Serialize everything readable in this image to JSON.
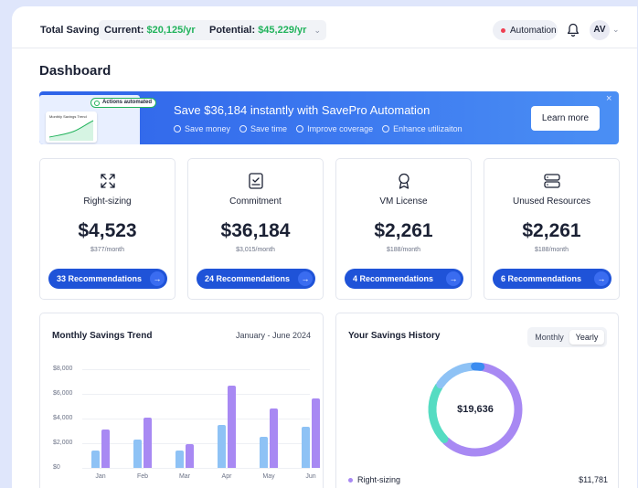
{
  "topbar": {
    "total_label": "Total Savings",
    "current_label": "Current:",
    "current_value": "$20,125/yr",
    "potential_label": "Potential:",
    "potential_value": "$45,229/yr",
    "automation_label": "Automation",
    "avatar_initials": "AV"
  },
  "page": {
    "title": "Dashboard"
  },
  "banner": {
    "badge": "Actions automated",
    "thumb_title": "Monthly Savings Trend",
    "title": "Save $36,184 instantly with SavePro Automation",
    "features": [
      "Save money",
      "Save time",
      "Improve coverage",
      "Enhance utilizaiton"
    ],
    "cta": "Learn more",
    "close": "×"
  },
  "cards": [
    {
      "title": "Right-sizing",
      "amount": "$4,523",
      "sub": "$377/month",
      "button": "33 Recommendations",
      "icon": "resize-arrows-icon"
    },
    {
      "title": "Commitment",
      "amount": "$36,184",
      "sub": "$3,015/month",
      "button": "24 Recommendations",
      "icon": "document-check-icon"
    },
    {
      "title": "VM License",
      "amount": "$2,261",
      "sub": "$188/month",
      "button": "4 Recommendations",
      "icon": "award-ribbon-icon"
    },
    {
      "title": "Unused Resources",
      "amount": "$2,261",
      "sub": "$188/month",
      "button": "6 Recommendations",
      "icon": "server-icon"
    }
  ],
  "trend": {
    "title": "Monthly Savings Trend",
    "range": "January - June 2024"
  },
  "chart_data": {
    "type": "bar",
    "categories": [
      "Jan",
      "Feb",
      "Mar",
      "Apr",
      "May",
      "Jun"
    ],
    "series": [
      {
        "values": [
          1400,
          2300,
          1400,
          3500,
          2500,
          3300
        ],
        "color": "#8ec2f5"
      },
      {
        "values": [
          3100,
          4100,
          1900,
          6700,
          4800,
          5600
        ],
        "color": "#a889f3"
      }
    ],
    "ytick_labels": [
      "$8,000",
      "$6,000",
      "$4,000",
      "$2,000",
      "$0"
    ],
    "ylim": [
      0,
      8000
    ],
    "grid": true
  },
  "history": {
    "title": "Your Savings History",
    "toggle": [
      "Monthly",
      "Yearly"
    ],
    "active_toggle": "Yearly",
    "total": "$19,636",
    "segments": [
      {
        "value": 11781,
        "color": "#a889f3"
      },
      {
        "value": 4320,
        "color": "#55dcc2"
      },
      {
        "value": 2935,
        "color": "#8ec2f5"
      },
      {
        "value": 600,
        "color": "#3b8cf0"
      }
    ],
    "legend": [
      {
        "name": "Right-sizing",
        "value": "$11,781"
      }
    ]
  },
  "colors": {
    "accent": "#1f53d8",
    "positive": "#22b35c",
    "alert": "#ef3f52"
  }
}
